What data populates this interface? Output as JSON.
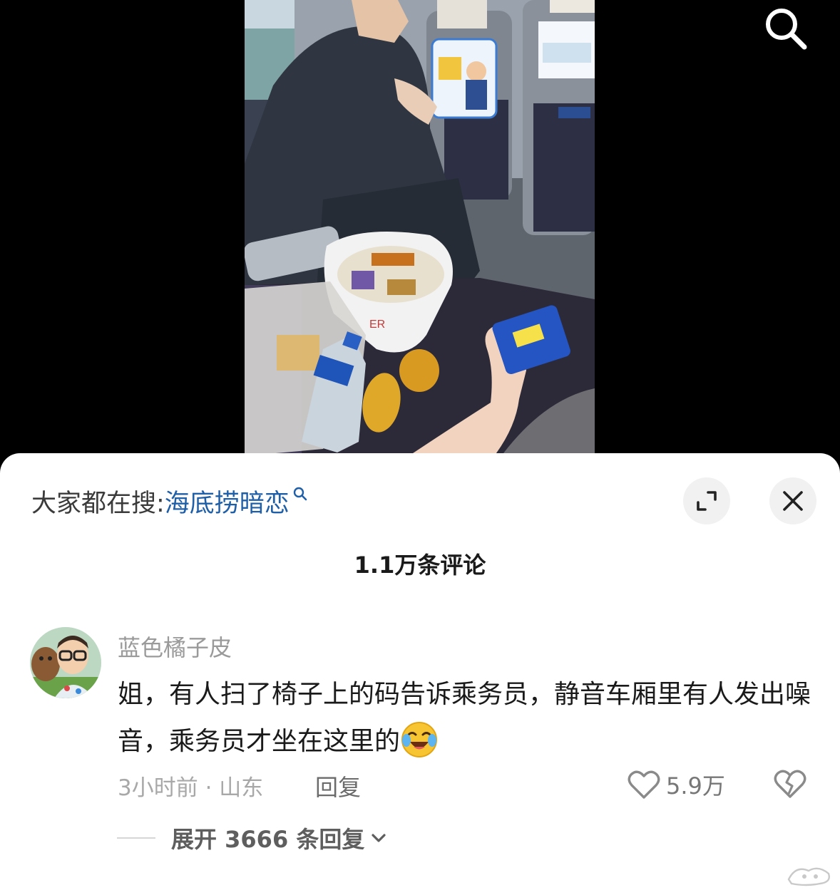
{
  "sheet": {
    "hot_search_prefix": "大家都在搜:",
    "hot_search_term": "海底捞暗恋",
    "comment_count_title": "1.1万条评论"
  },
  "comment": {
    "username": "蓝色橘子皮",
    "text": "姐，有人扫了椅子上的码告诉乘务员，静音车厢里有人发出噪音，乘务员才坐在这里的",
    "emoji": "crying-laughing-emoji",
    "meta": "3小时前 · 山东",
    "reply_label": "回复",
    "like_count": "5.9万",
    "expand_label": "展开 3666 条回复"
  },
  "icons": {
    "search": "search-icon",
    "expand": "expand-icon",
    "close": "close-icon",
    "like": "heart-outline-icon",
    "dislike": "broken-heart-icon",
    "chevron": "chevron-down-icon"
  },
  "colors": {
    "link_blue": "#1f5fa8",
    "sheet_bg": "#ffffff",
    "muted_text": "#9a9a9a"
  }
}
